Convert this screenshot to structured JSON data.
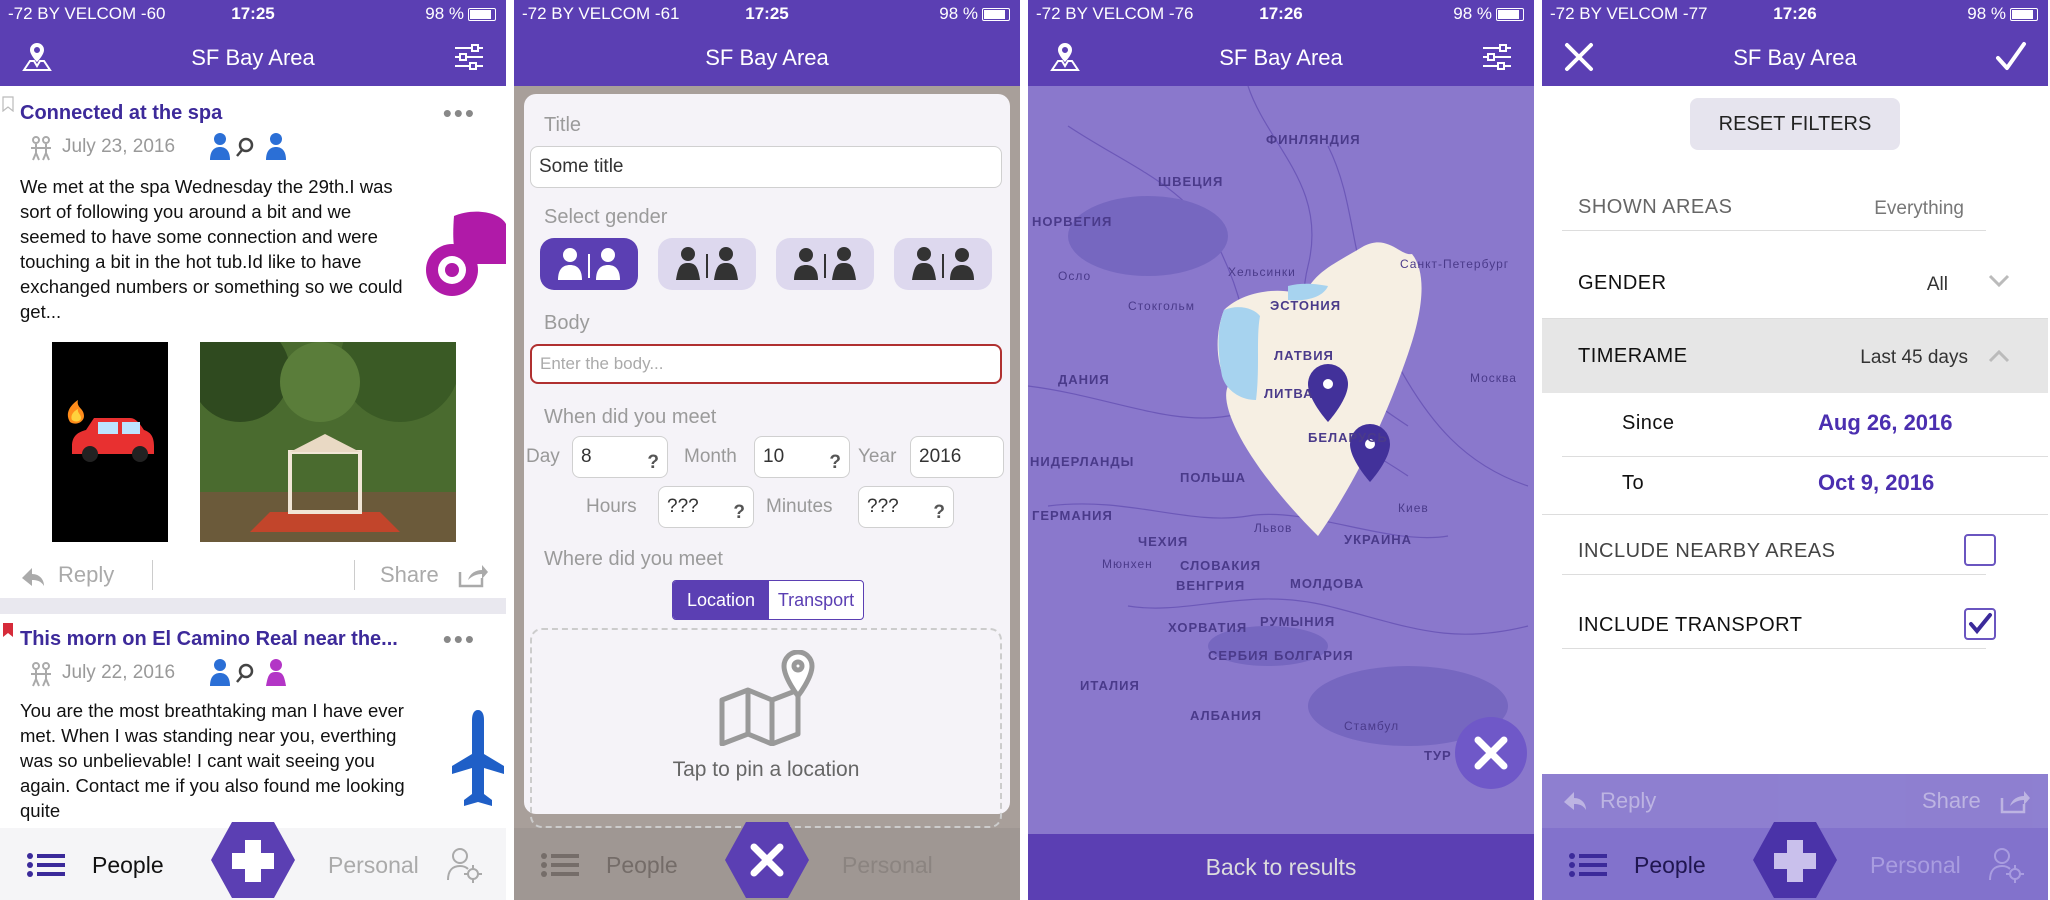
{
  "status_bars": [
    {
      "carrier": "-72 BY VELCOM -60",
      "time": "17:25",
      "battery": "98 %"
    },
    {
      "carrier": "-72 BY VELCOM -61",
      "time": "17:25",
      "battery": "98 %"
    },
    {
      "carrier": "-72 BY VELCOM -76",
      "time": "17:26",
      "battery": "98 %"
    },
    {
      "carrier": "-72 BY VELCOM -77",
      "time": "17:26",
      "battery": "98 %"
    }
  ],
  "nav_title": "SF Bay Area",
  "colors": {
    "brand": "#5b3fb3",
    "accent_text": "#3d2a9a",
    "error_border": "#b03030"
  },
  "feed": {
    "posts": [
      {
        "title": "Connected at the spa",
        "date": "July 23, 2016",
        "body": "We met at the spa Wednesday the 29th.I was sort of following you around a bit and we seemed to have some connection and were touching a bit in the hot tub.Id like to have exchanged numbers or something so we could get...",
        "more": "•••",
        "icon": "motorcycle-icon"
      },
      {
        "title": "This morn on El Camino Real near the...",
        "date": "July 22, 2016",
        "body": "You are the most breathtaking man I have ever met. When I was standing near you, everthing was so unbelievable! I cant wait seeing you again. Contact me if you also found me looking quite",
        "more": "•••",
        "icon": "airplane-icon"
      }
    ],
    "reply_label": "Reply",
    "share_label": "Share"
  },
  "bottom_nav": {
    "people_label": "People",
    "personal_label": "Personal"
  },
  "form": {
    "title_label": "Title",
    "title_value": "Some title",
    "gender_label": "Select gender",
    "body_label": "Body",
    "body_placeholder": "Enter the body...",
    "when_label": "When did you meet",
    "day_label": "Day",
    "day_value": "8",
    "month_label": "Month",
    "month_value": "10",
    "year_label": "Year",
    "year_value": "2016",
    "hours_label": "Hours",
    "hours_value": "???",
    "minutes_label": "Minutes",
    "minutes_value": "???",
    "qmark": "?",
    "where_label": "Where did you meet",
    "where_options": [
      "Location",
      "Transport"
    ],
    "pin_label": "Tap to pin a location"
  },
  "map": {
    "labels": [
      "ФИНЛЯНДИЯ",
      "ШВЕЦИЯ",
      "НОРВЕГИЯ",
      "Хельсинки",
      "Санкт-Петербург",
      "Осло",
      "Стокгольм",
      "ЭСТОНИЯ",
      "ЛАТВИЯ",
      "ЛИТВА",
      "БЕЛАРУСЬ",
      "ДАНИЯ",
      "ПОЛЬША",
      "ГЕРМАНИЯ",
      "Москва",
      "Львов",
      "Киев",
      "УКРАИНА",
      "ЧЕХИЯ",
      "СЛОВАКИЯ",
      "ВЕНГРИЯ",
      "МОЛДОВА",
      "Мюнхен",
      "РУМЫНИЯ",
      "ХОРВАТИЯ",
      "СЕРБИЯ",
      "БОЛГАРИЯ",
      "ИТАЛИЯ",
      "АЛБАНИЯ",
      "Стамбул",
      "ТУР",
      "НИДЕРЛАНДЫ"
    ],
    "back_label": "Back to results"
  },
  "filters": {
    "reset_label": "RESET FILTERS",
    "shown_areas_label": "SHOWN AREAS",
    "shown_areas_value": "Everything",
    "gender_label": "GENDER",
    "gender_value": "All",
    "timeframe_label": "TIMERAME",
    "timeframe_value": "Last 45 days",
    "since_label": "Since",
    "since_value": "Aug 26, 2016",
    "to_label": "To",
    "to_value": "Oct 9, 2016",
    "nearby_label": "INCLUDE NEARBY AREAS",
    "nearby_checked": false,
    "transport_label": "INCLUDE TRANSPORT",
    "transport_checked": true
  }
}
